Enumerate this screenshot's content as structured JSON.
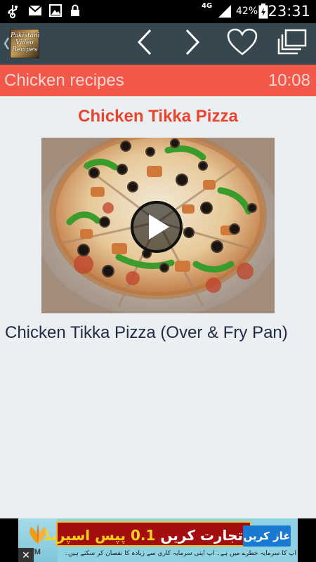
{
  "status_bar": {
    "network": "4G",
    "battery_percent": "42%",
    "time": "23:31",
    "icons": [
      "usb-icon",
      "mail-icon",
      "image-icon",
      "lock-icon",
      "signal-icon",
      "battery-icon"
    ]
  },
  "action_bar": {
    "app_logo_text": "Pakistani Video Recipes",
    "icons": [
      "back-chevron-icon",
      "previous-icon",
      "next-icon",
      "favorite-heart-icon",
      "gallery-copy-icon"
    ]
  },
  "sub_header": {
    "title": "Chicken recipes",
    "duration": "10:08"
  },
  "recipe": {
    "title": "Chicken Tikka Pizza",
    "caption": "Chicken Tikka Pizza (Over & Fry Pan)",
    "thumbnail_icon": "play-icon"
  },
  "ad": {
    "brand": "FXTM",
    "headline_prefix": "تجارت کریں",
    "headline_number": "0.1",
    "headline_suffix": "پپس اسپریڈ",
    "cta": "غاز کریں",
    "disclaimer": "آپ کا سرمایہ خطرے میں ہے۔ آپ اپنی سرمایہ کاری سے زیادہ کا نقصان کر سکتے ہیں۔",
    "close_label": "✕"
  },
  "colors": {
    "status_bar": "#000000",
    "action_bar": "#37474f",
    "sub_header": "#f2584a",
    "title_red": "#e8452f",
    "background": "#eceff1"
  }
}
